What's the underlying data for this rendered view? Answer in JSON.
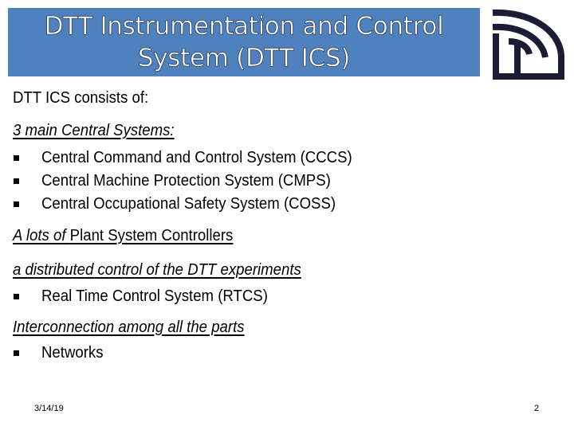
{
  "slide": {
    "title_lines": [
      "DTT Instrumentation and Control",
      "System (DTT ICS)"
    ],
    "banner_color": "#4F81BD",
    "logo": {
      "icon": "dtt-logo-icon",
      "color": "#1a1d33"
    },
    "intro": "DTT ICS consists of:",
    "sections": [
      {
        "heading_italic": " 3 main Central Systems:",
        "heading_plain": "",
        "bullets": [
          "Central Command and Control System (CCCS)",
          "Central Machine Protection System (CMPS)",
          "Central Occupational Safety System (COSS)"
        ]
      },
      {
        "heading_italic": "A lots of ",
        "heading_plain": " Plant System Controllers",
        "bullets": []
      },
      {
        "heading_italic": "a distributed control of the DTT experiments",
        "heading_plain": "",
        "bullets": [
          "Real Time Control System (RTCS)"
        ]
      },
      {
        "heading_italic": "Interconnection among all the parts",
        "heading_plain": "",
        "bullets": [
          "Networks"
        ]
      }
    ],
    "bullet_icon": "square-bullet-icon",
    "footer": {
      "date": "3/14/19",
      "page_number": "2"
    }
  }
}
